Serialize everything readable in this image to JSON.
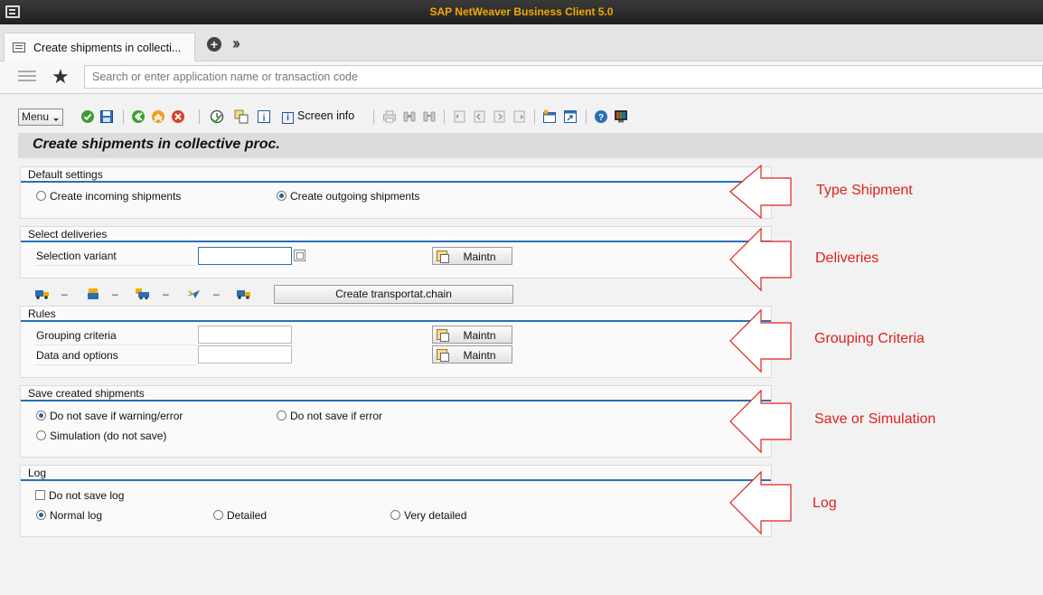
{
  "window": {
    "title": "SAP NetWeaver Business Client 5.0"
  },
  "tabs": [
    {
      "label": "Create shipments in collecti..."
    }
  ],
  "search": {
    "placeholder": "Search or enter application name or transaction code"
  },
  "toolbar": {
    "menu_label": "Menu",
    "screen_info_label": "Screen info"
  },
  "page": {
    "title": "Create shipments in collective proc."
  },
  "default_settings": {
    "title": "Default settings",
    "incoming_label": "Create incoming shipments",
    "outgoing_label": "Create outgoing shipments",
    "selected": "outgoing"
  },
  "select_deliveries": {
    "title": "Select deliveries",
    "selection_variant_label": "Selection variant",
    "selection_variant_value": "",
    "maintain_label": "Maintn"
  },
  "transport_chain": {
    "button_label": "Create transportat.chain",
    "separator": "–",
    "icons": [
      "truck-icon",
      "loading-point-icon",
      "shipping-point-icon",
      "airplane-icon",
      "truck-icon"
    ]
  },
  "rules": {
    "title": "Rules",
    "grouping_criteria_label": "Grouping criteria",
    "grouping_criteria_value": "",
    "data_options_label": "Data and options",
    "data_options_value": "",
    "maintain_label": "Maintn"
  },
  "save_shipments": {
    "title": "Save created shipments",
    "option_warning_error": "Do not save if warning/error",
    "option_error": "Do not save if error",
    "option_simulation": "Simulation (do not save)",
    "selected": "warning_error"
  },
  "log": {
    "title": "Log",
    "do_not_save_label": "Do not save log",
    "do_not_save_checked": false,
    "normal_label": "Normal log",
    "detailed_label": "Detailed",
    "very_detailed_label": "Very detailed",
    "selected": "normal"
  },
  "annotations": {
    "color": "#e0211c",
    "type_shipment": "Type Shipment",
    "deliveries": "Deliveries",
    "grouping_criteria": "Grouping Criteria",
    "save_or_simulation": "Save or Simulation",
    "log": "Log"
  },
  "colors": {
    "accent_line": "#2a6fb5",
    "title_text": "#f0ab00"
  }
}
